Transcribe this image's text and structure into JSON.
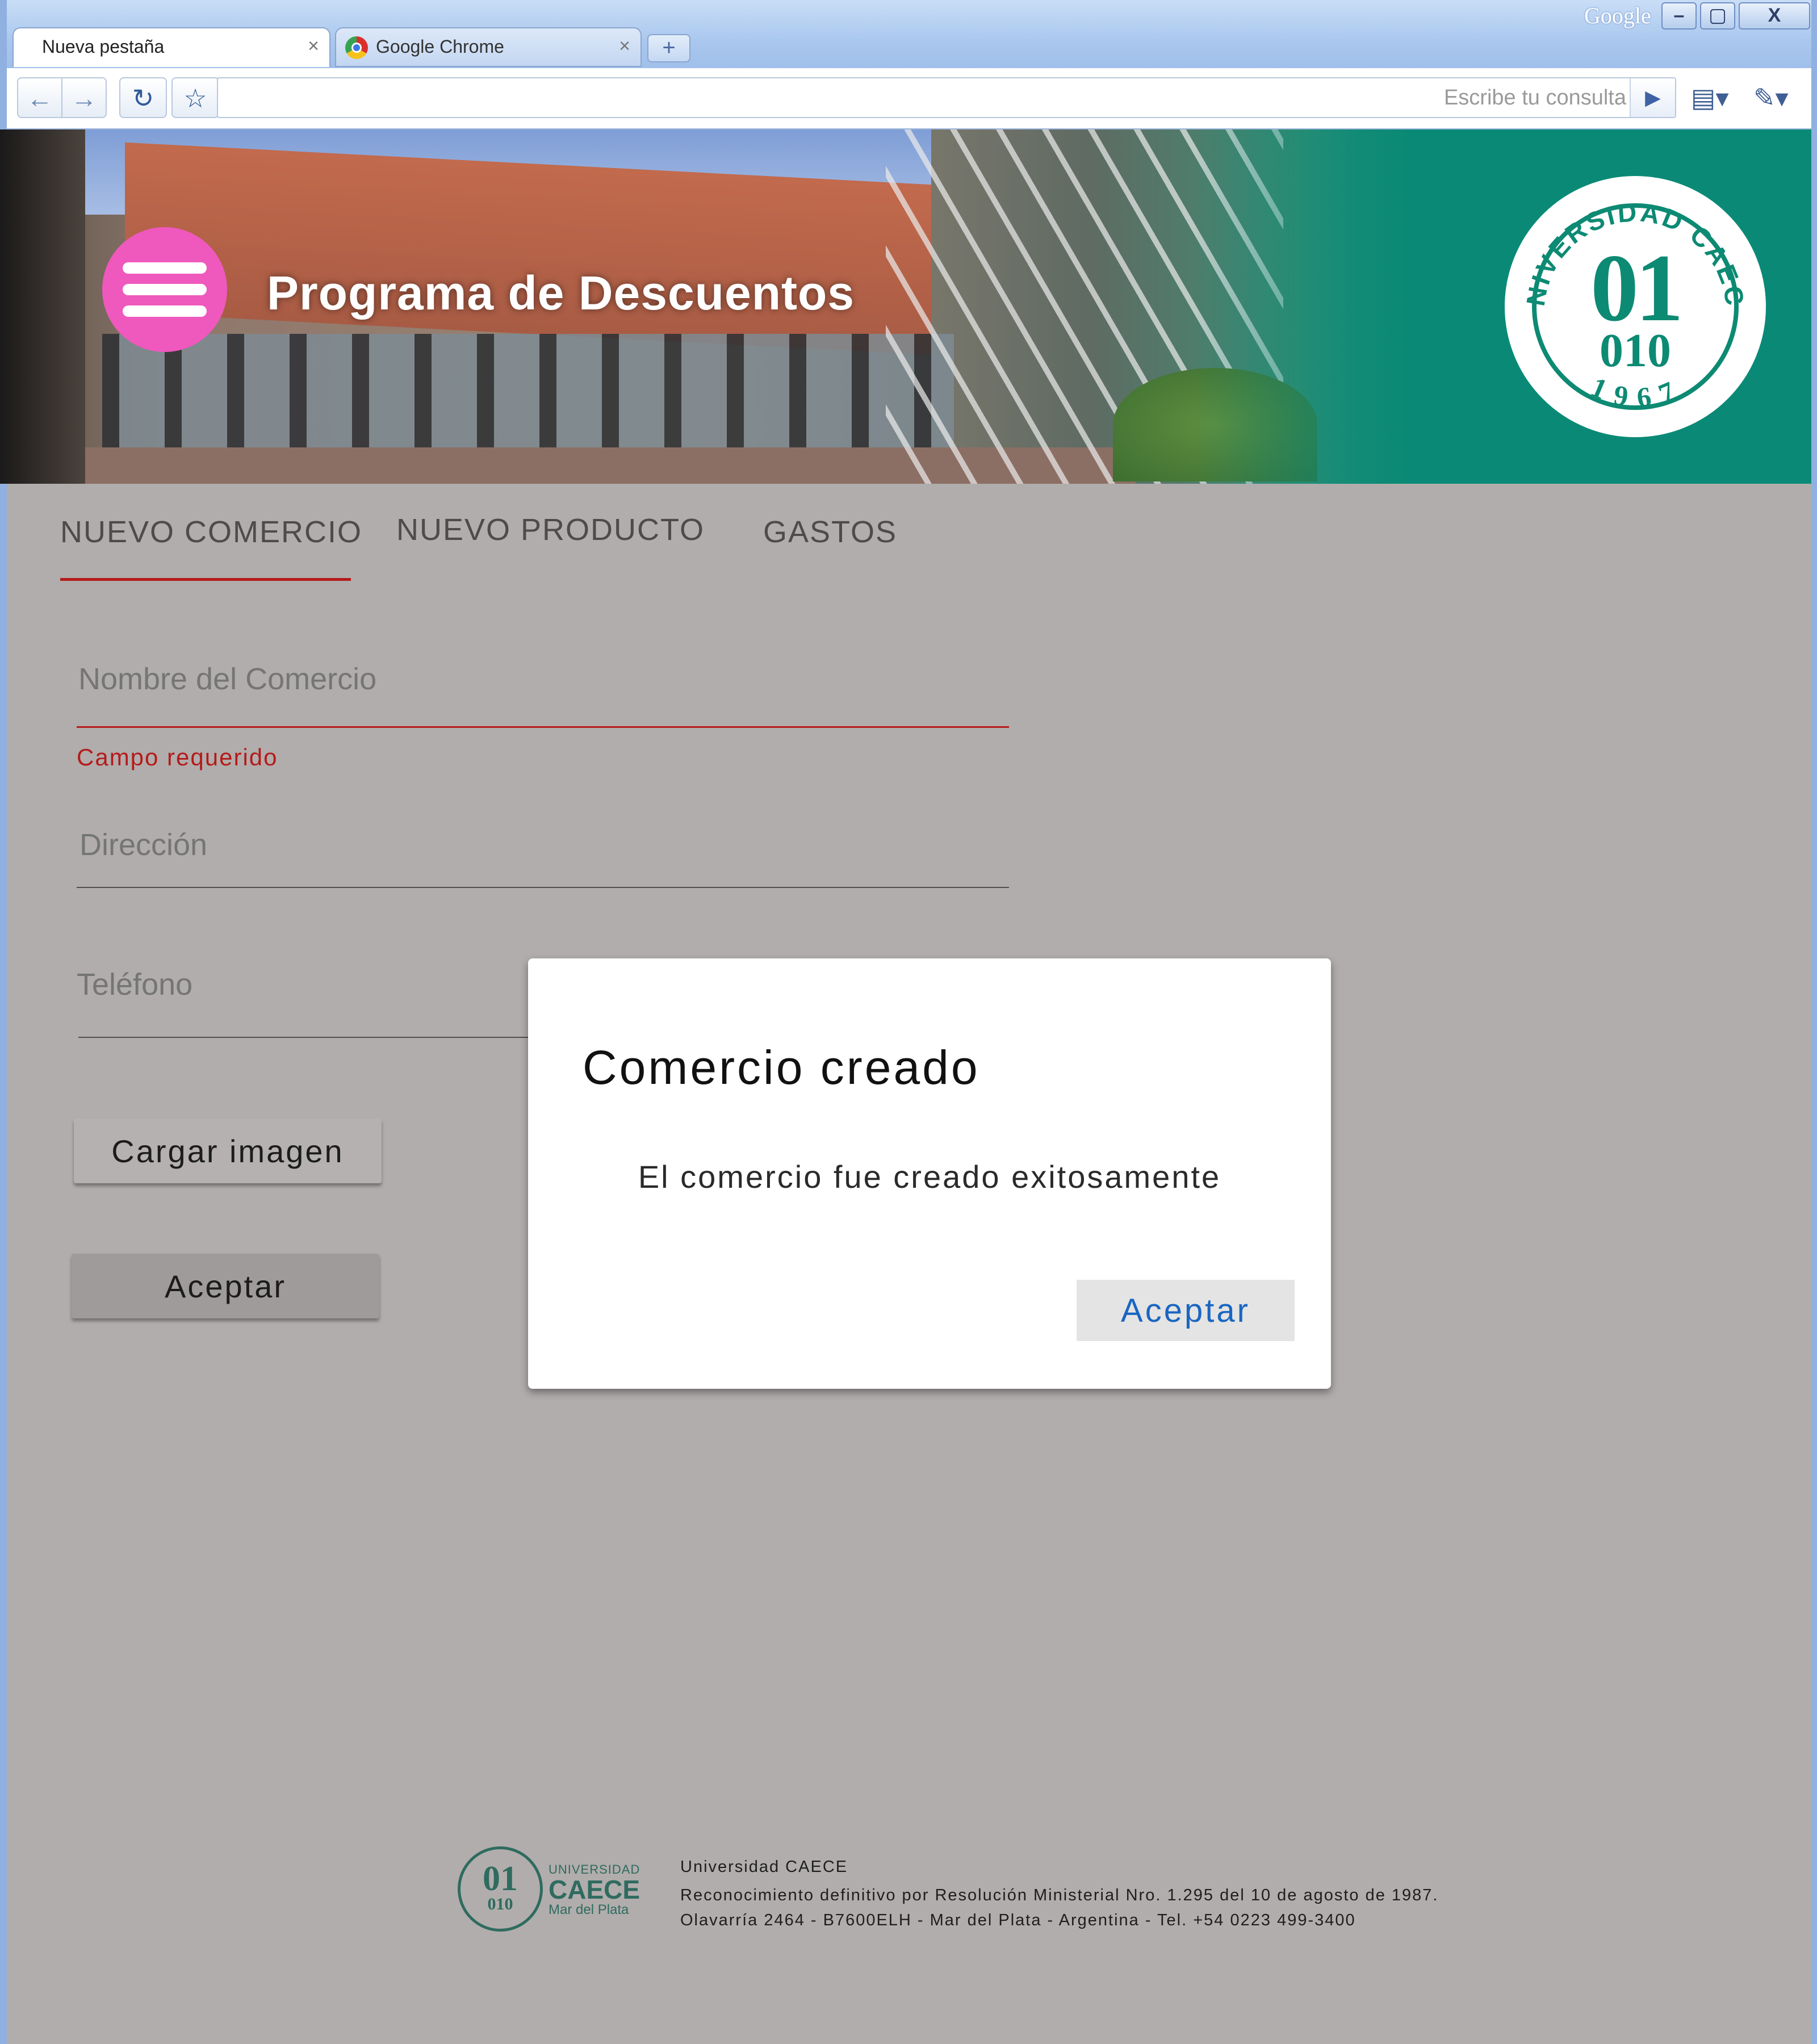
{
  "browser": {
    "brand_label": "Google",
    "window_controls": {
      "minimize": "–",
      "maximize": "▢",
      "close": "X"
    },
    "tabs": [
      {
        "label": "Nueva pestaña",
        "active": true,
        "close": "×"
      },
      {
        "label": "Google Chrome",
        "active": false,
        "close": "×"
      }
    ],
    "new_tab": "+",
    "toolbar": {
      "back_icon": "←",
      "forward_icon": "→",
      "reload_icon": "↻",
      "star_icon": "☆",
      "omnibox_value": "",
      "omnibox_placeholder": "Escribe tu consulta",
      "go_icon": "▶",
      "page_menu_icon": "▤▾",
      "tools_menu_icon": "✎▾"
    }
  },
  "header": {
    "title": "Programa de Descuentos",
    "logo": {
      "ring_text": "UNIVERSIDAD CAECE",
      "num_top": "01",
      "num_bottom": "010",
      "year": "1967"
    },
    "colors": {
      "menu_button": "#ef58bd",
      "teal": "#0a8a76"
    }
  },
  "tabs": [
    {
      "label": "NUEVO COMERCIO",
      "active": true
    },
    {
      "label": "NUEVO PRODUCTO",
      "active": false
    },
    {
      "label": "GASTOS",
      "active": false
    }
  ],
  "form": {
    "name": {
      "placeholder": "Nombre del Comercio",
      "value": "",
      "error": "Campo requerido"
    },
    "address": {
      "placeholder": "Dirección",
      "value": ""
    },
    "phone": {
      "placeholder": "Teléfono",
      "value": ""
    },
    "load_image_label": "Cargar imagen",
    "accept_label": "Aceptar"
  },
  "dialog": {
    "title": "Comercio creado",
    "message": "El comercio fue creado exitosamente",
    "ok_label": "Aceptar"
  },
  "footer": {
    "logo": {
      "num_top": "01",
      "num_bottom": "010",
      "small": "UNIVERSIDAD",
      "brand": "CAECE",
      "city": "Mar del Plata"
    },
    "lines": [
      "Universidad CAECE",
      "Reconocimiento definitivo por Resolución Ministerial Nro. 1.295 del 10 de agosto de 1987.",
      "Olavarría 2464 - B7600ELH - Mar del Plata - Argentina - Tel. +54 0223 499-3400"
    ]
  }
}
